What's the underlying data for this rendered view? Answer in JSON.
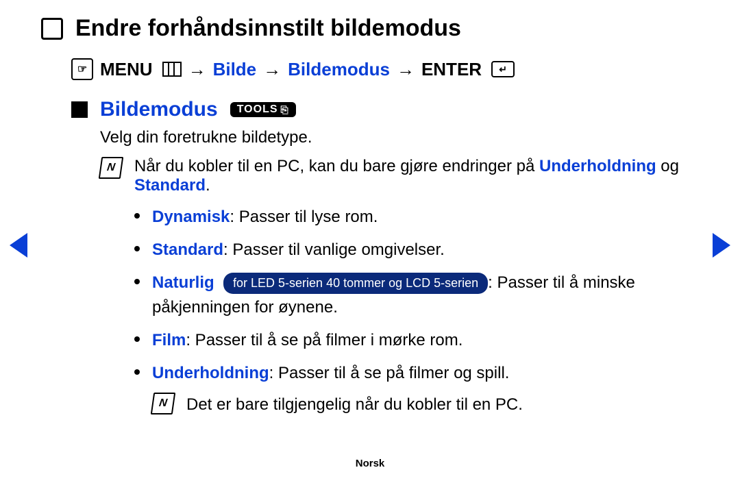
{
  "title": "Endre forhåndsinnstilt bildemodus",
  "path": {
    "menu_label": "MENU",
    "arrow": "→",
    "p1": "Bilde",
    "p2": "Bildemodus",
    "enter_label": "ENTER"
  },
  "section": {
    "title": "Bildemodus",
    "tools_label": "TOOLS"
  },
  "intro": "Velg din foretrukne bildetype.",
  "note1": {
    "pre": "Når du kobler til en PC, kan du bare gjøre endringer på ",
    "blue1": "Underholdning",
    "mid": " og ",
    "blue2": "Standard",
    "end": "."
  },
  "modes": {
    "dynamic": {
      "label": "Dynamisk",
      "text": ": Passer til lyse rom."
    },
    "standard": {
      "label": "Standard",
      "text": ": Passer til vanlige omgivelser."
    },
    "natural": {
      "label": "Naturlig",
      "pill": "for LED 5-serien 40 tommer og LCD 5-serien",
      "text": ": Passer til å minske påkjenningen for øynene."
    },
    "film": {
      "label": "Film",
      "text": ": Passer til å se på filmer i mørke rom."
    },
    "entertainment": {
      "label": "Underholdning",
      "text": ": Passer til å se på filmer og spill."
    }
  },
  "note2": "Det er bare tilgjengelig når du kobler til en PC.",
  "language": "Norsk"
}
